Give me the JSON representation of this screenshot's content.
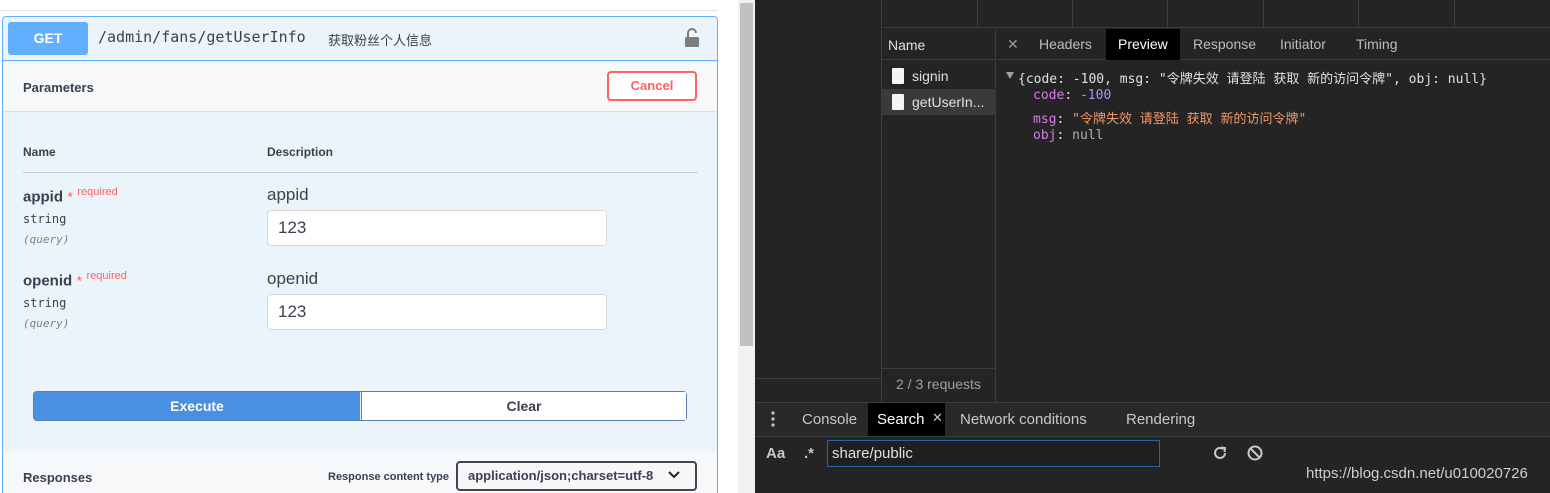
{
  "swagger": {
    "method": "GET",
    "path": "/admin/fans/getUserInfo",
    "summary": "获取粉丝个人信息",
    "parameters_title": "Parameters",
    "cancel_label": "Cancel",
    "columns": {
      "name": "Name",
      "description": "Description"
    },
    "params": [
      {
        "name": "appid",
        "required_star": "*",
        "required_label": "required",
        "type": "string",
        "in": "(query)",
        "description": "appid",
        "value": "123"
      },
      {
        "name": "openid",
        "required_star": "*",
        "required_label": "required",
        "type": "string",
        "in": "(query)",
        "description": "openid",
        "value": "123"
      }
    ],
    "execute_label": "Execute",
    "clear_label": "Clear",
    "responses_title": "Responses",
    "response_content_type_label": "Response content type",
    "response_content_type_value": "application/json;charset=utf-8"
  },
  "devtools": {
    "name_header": "Name",
    "requests": [
      "signin",
      "getUserIn..."
    ],
    "request_count": "2 / 3 requests",
    "tabs": [
      "Headers",
      "Preview",
      "Response",
      "Initiator",
      "Timing"
    ],
    "active_tab": "Preview",
    "preview": {
      "summary": "{code: -100, msg: \"令牌失效 请登陆 获取 新的访问令牌\", obj: null}",
      "code_key": "code",
      "code_value": "-100",
      "msg_key": "msg",
      "msg_value": "\"令牌失效 请登陆 获取 新的访问令牌\"",
      "obj_key": "obj",
      "obj_value": "null"
    },
    "drawer_tabs": [
      "Console",
      "Search",
      "Network conditions",
      "Rendering"
    ],
    "drawer_active": "Search",
    "search": {
      "case_label": "Aa",
      "regex_label": ".*",
      "value": "share/public"
    }
  },
  "watermark": "https://blog.csdn.net/u010020726",
  "colors": {
    "get_blue": "#61affe",
    "execute_blue": "#4990e2",
    "cancel_red": "#ff6060",
    "devtools_bg": "#242424"
  }
}
